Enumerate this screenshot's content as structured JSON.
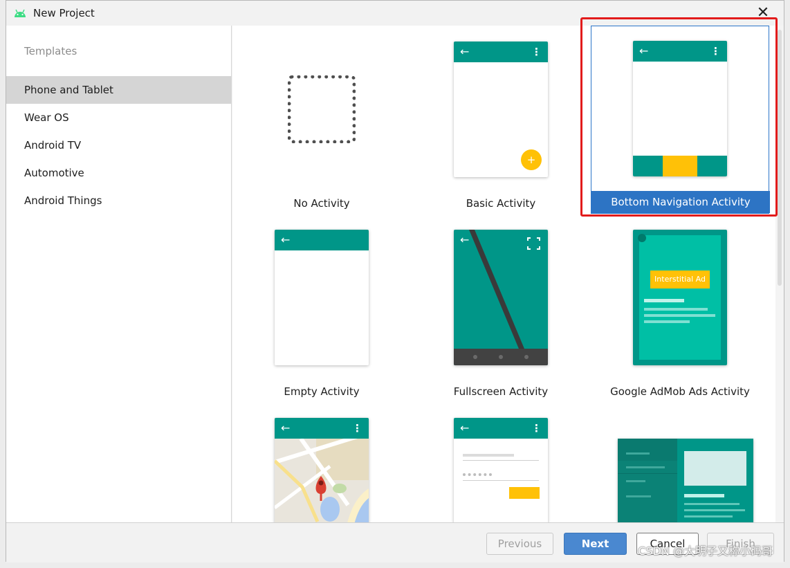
{
  "window": {
    "title": "New Project",
    "close_symbol": "✕"
  },
  "sidebar": {
    "header": "Templates",
    "items": [
      {
        "label": "Phone and Tablet",
        "selected": true
      },
      {
        "label": "Wear OS"
      },
      {
        "label": "Android TV"
      },
      {
        "label": "Automotive"
      },
      {
        "label": "Android Things"
      }
    ]
  },
  "templates": [
    {
      "label": "No Activity"
    },
    {
      "label": "Basic Activity",
      "fab_symbol": "+"
    },
    {
      "label": "Bottom Navigation Activity",
      "selected": true
    },
    {
      "label": "Empty Activity"
    },
    {
      "label": "Fullscreen Activity"
    },
    {
      "label": "Google AdMob Ads Activity",
      "ad_text": "Interstitial Ad"
    },
    {
      "label": ""
    },
    {
      "label": ""
    },
    {
      "label": ""
    }
  ],
  "footer": {
    "previous": "Previous",
    "next": "Next",
    "cancel": "Cancel",
    "finish": "Finish"
  },
  "watermark": "CSDN @大明子又称小码哥",
  "colors": {
    "teal": "#009688",
    "accent": "#FFC107",
    "selection": "#2D74C4",
    "highlight_box": "#E21B1B"
  },
  "icons": {
    "back": "←",
    "overflow": "⋮"
  }
}
